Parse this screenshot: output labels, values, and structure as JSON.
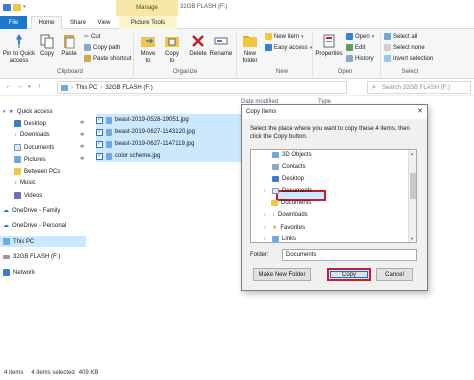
{
  "window": {
    "title": "32GB FLASH (F:)",
    "context_tab": "Manage"
  },
  "tabs": {
    "file": "File",
    "home": "Home",
    "share": "Share",
    "view": "View",
    "picture_tools": "Picture Tools"
  },
  "ribbon": {
    "clipboard": {
      "label": "Clipboard",
      "pin": "Pin to Quick\naccess",
      "copy": "Copy",
      "paste": "Paste",
      "cut": "Cut",
      "copy_path": "Copy path",
      "paste_shortcut": "Paste shortcut"
    },
    "organize": {
      "label": "Organize",
      "move_to": "Move\nto",
      "copy_to": "Copy\nto",
      "delete": "Delete",
      "rename": "Rename"
    },
    "new": {
      "label": "New",
      "new_folder": "New\nfolder",
      "new_item": "New item",
      "easy_access": "Easy access"
    },
    "open": {
      "label": "Open",
      "properties": "Properties",
      "open": "Open",
      "edit": "Edit",
      "history": "History"
    },
    "select": {
      "label": "Select",
      "select_all": "Select all",
      "select_none": "Select none",
      "invert_selection": "Invert selection"
    }
  },
  "address": {
    "path": [
      "This PC",
      "32GB FLASH (F:)"
    ],
    "search_placeholder": "Search 32GB FLASH (F:)"
  },
  "nav": {
    "items": [
      {
        "label": "Quick access"
      },
      {
        "label": "Desktop"
      },
      {
        "label": "Downloads"
      },
      {
        "label": "Documents"
      },
      {
        "label": "Pictures"
      },
      {
        "label": "Between PCs"
      },
      {
        "label": "Music"
      },
      {
        "label": "Videos"
      },
      {
        "label": "OneDrive - Family"
      },
      {
        "label": "OneDrive - Personal"
      },
      {
        "label": "This PC"
      },
      {
        "label": "32GB FLASH (F:)"
      },
      {
        "label": "Network"
      }
    ]
  },
  "files": {
    "col_date": "Date modified",
    "col_type": "Type",
    "rows": [
      {
        "name": "beast-2019-0528-19051.jpg"
      },
      {
        "name": "beast-2019-0627-1143120.jpg"
      },
      {
        "name": "beast-2019-0627-1147119.jpg"
      },
      {
        "name": "color scheme.jpg"
      }
    ]
  },
  "status": {
    "count": "4 items",
    "selected": "4 items selected",
    "size": "409 KB"
  },
  "dialog": {
    "title": "Copy Items",
    "close": "✕",
    "message": "Select the place where you want to copy these 4 items, then click the Copy button.",
    "tree": [
      {
        "label": "3D Objects"
      },
      {
        "label": "Contacts"
      },
      {
        "label": "Desktop"
      },
      {
        "label": "Documents"
      },
      {
        "label": "Documents"
      },
      {
        "label": "Downloads"
      },
      {
        "label": "Favorites"
      },
      {
        "label": "Links"
      }
    ],
    "folder_label": "Folder:",
    "folder_value": "Documents",
    "new_folder_btn": "Make New Folder",
    "copy_btn": "Copy",
    "cancel_btn": "Cancel"
  },
  "colors": {
    "accent": "#1979ca",
    "highlight": "#c41f2b",
    "selection": "#cce8ff"
  }
}
